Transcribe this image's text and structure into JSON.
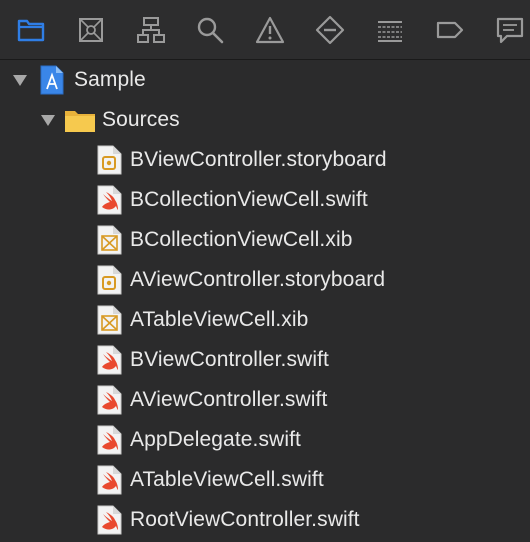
{
  "navigator": {
    "toolbar": [
      {
        "icon": "folder-icon",
        "active": true
      },
      {
        "icon": "source-control-icon",
        "active": false
      },
      {
        "icon": "hierarchy-icon",
        "active": false
      },
      {
        "icon": "search-icon",
        "active": false
      },
      {
        "icon": "warning-icon",
        "active": false
      },
      {
        "icon": "test-diamond-icon",
        "active": false
      },
      {
        "icon": "debug-list-icon",
        "active": false
      },
      {
        "icon": "breakpoint-tag-icon",
        "active": false
      },
      {
        "icon": "report-speech-icon",
        "active": false
      }
    ],
    "accent_color": "#2f7ee6",
    "icon_color": "#9a9a9a"
  },
  "tree": {
    "project": {
      "label": "Sample",
      "icon": "xcode-project-icon",
      "expanded": true
    },
    "group": {
      "label": "Sources",
      "icon": "folder-icon",
      "expanded": true
    },
    "files": [
      {
        "label": "BViewController.storyboard",
        "icon": "storyboard-file-icon"
      },
      {
        "label": "BCollectionViewCell.swift",
        "icon": "swift-file-icon"
      },
      {
        "label": "BCollectionViewCell.xib",
        "icon": "xib-file-icon"
      },
      {
        "label": "AViewController.storyboard",
        "icon": "storyboard-file-icon"
      },
      {
        "label": "ATableViewCell.xib",
        "icon": "xib-file-icon"
      },
      {
        "label": "BViewController.swift",
        "icon": "swift-file-icon"
      },
      {
        "label": "AViewController.swift",
        "icon": "swift-file-icon"
      },
      {
        "label": "AppDelegate.swift",
        "icon": "swift-file-icon"
      },
      {
        "label": "ATableViewCell.swift",
        "icon": "swift-file-icon"
      },
      {
        "label": "RootViewController.swift",
        "icon": "swift-file-icon"
      }
    ]
  }
}
